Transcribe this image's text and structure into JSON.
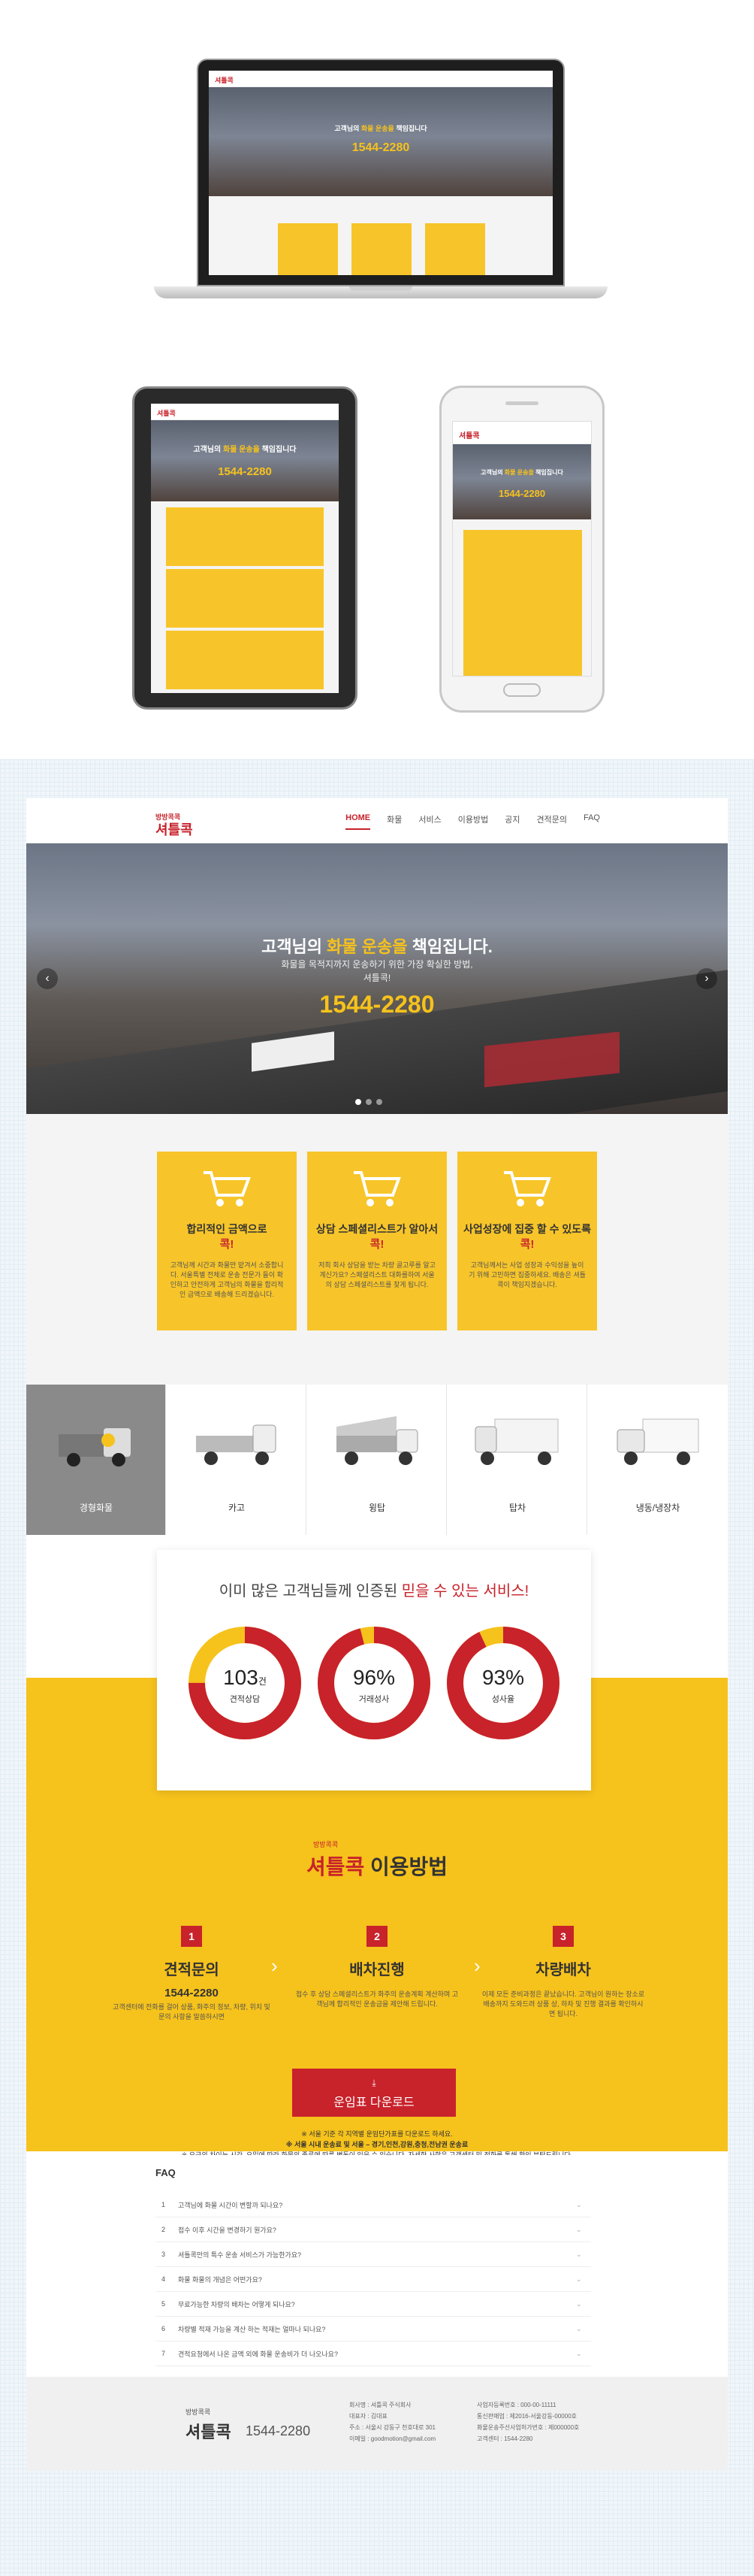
{
  "brand": {
    "small": "방방콕콕",
    "name": "셔틀콕"
  },
  "nav": {
    "items": [
      "HOME",
      "화물",
      "서비스",
      "이용방법",
      "공지",
      "견적문의",
      "FAQ"
    ]
  },
  "hero": {
    "title_pre": "고객님의 ",
    "title_em": "화물 운송을",
    "title_post": " 책임집니다.",
    "sub1": "화물을 목적지까지 운송하기 위한 가장 확실한 방법,",
    "sub2": "셔틀콕!",
    "phone": "1544-2280",
    "prev": "‹",
    "next": "›"
  },
  "mini": {
    "hero_pre": "고객님의 ",
    "hero_em": "화물 운송을",
    "hero_post": " 책임집니다",
    "phone": "1544-2280"
  },
  "features": [
    {
      "title": "합리적인 금액으로",
      "accent": "콕!",
      "desc": "고객님께 시간과 화물만 맡겨서 소중합니다. 서울특별 전체로 운송 전문가 들이 확인하고 안전하게 고객님의 화물을 합리적인 금액으로 배송해 드리겠습니다."
    },
    {
      "title": "상담 스페셜리스트가 알아서",
      "accent": "콕!",
      "desc": "저희 회사 상담을 받는 차량 골고루를 알고 계신가요? 스페셜리스트 대화를하여 서울의 상담 스페셜리스트를 찾게 됩니다."
    },
    {
      "title": "사업성장에 집중 할 수 있도록",
      "accent": "콕!",
      "desc": "고객님께서는 사업 성장과 수익성을 높이기 위해 고민하면 집중하세요. 배송은 셔틀콕이 책임지겠습니다."
    }
  ],
  "vehicles": [
    "경형화물",
    "카고",
    "윙탑",
    "탑차",
    "냉동/냉장차"
  ],
  "stats": {
    "head_pre": "이미 많은 고객님들께 인증된 ",
    "head_em": "믿을 수 있는 서비스!",
    "items": [
      {
        "num": "103",
        "unit": "건",
        "label": "견적상담",
        "pct": 0.75
      },
      {
        "num": "96%",
        "unit": "",
        "label": "거래성사",
        "pct": 0.96
      },
      {
        "num": "93%",
        "unit": "",
        "label": "성사율",
        "pct": 0.93
      }
    ]
  },
  "howto": {
    "small": "방방콕콕",
    "brand": "셔틀콕",
    "title": " 이용방법",
    "steps": [
      {
        "num": "1",
        "title": "견적문의",
        "sub": "1544-2280",
        "desc": "고객센터에 전화를 걸어 상품, 화주의 정보, 차량, 위치 및 문의 사항을 말씀하시면"
      },
      {
        "num": "2",
        "title": "배차진행",
        "sub": "",
        "desc": "접수 후 상담 스페셜리스트가 화주의 운송계획 계산하며 고객님께 합리적인 운송금을 제안해 드립니다."
      },
      {
        "num": "3",
        "title": "차량배차",
        "sub": "",
        "desc": "이제 모든 준비과정은 끝났습니다. 고객님이 원하는 장소로 배송까지 도와드려 상품 상, 하차 및 진행 결과를 확인하시면 됩니다."
      }
    ],
    "chevron": "›",
    "download_icon": "⤓",
    "download": "운임표 다운로드",
    "note1": "※ 서울 기준 각 지역별 운임단가표를 다운로드 하세요.",
    "note2": "※ 서울 시내 운송료 및 서울 – 경기,인천,강원,충청,전남권 운송료",
    "note3": "※ 요금의 차이는 시간, 요일에 따라 화물의 종류에 따른 변동이 있을 수 있습니다. 자세한 사항은 고객센터 및 전화를 통해 확인 부탁드립니다."
  },
  "faq": {
    "title": "FAQ",
    "items": [
      {
        "n": "1",
        "q": "고객님에 화물 시간이 변할까 되나요?"
      },
      {
        "n": "2",
        "q": "접수 이후 시간을 변경하기 원가요?"
      },
      {
        "n": "3",
        "q": "셔틀콕만의 특수 운송 서비스가 가능한가요?"
      },
      {
        "n": "4",
        "q": "화물 화물의 개념은 어떤가요?"
      },
      {
        "n": "5",
        "q": "무료가능한 차량의 배차는 어떻게 되나요?"
      },
      {
        "n": "6",
        "q": "차량별 적재 가능을 계산 하는 적재는 얼마나 되나요?"
      },
      {
        "n": "7",
        "q": "견적요청에서 나온 금액 외에 화물 운송비가 더 나오나요?"
      }
    ],
    "chev": "⌄"
  },
  "footer": {
    "small": "방방콕콕",
    "brand": "셔틀콕",
    "phone": "1544-2280",
    "col1": [
      "회사명 : 셔틀콕 주식회사",
      "대표자 : 김대표",
      "주소 : 서울시 강동구 천호대로 301",
      "이메일 : goodmotion@gmail.com"
    ],
    "col2": [
      "사업자등록번호 : 000-00-11111",
      "통신판매업 : 제2016-서울강동-00000호",
      "화물운송주선사업허가번호 : 제000000호",
      "고객센터 : 1544-2280"
    ]
  }
}
